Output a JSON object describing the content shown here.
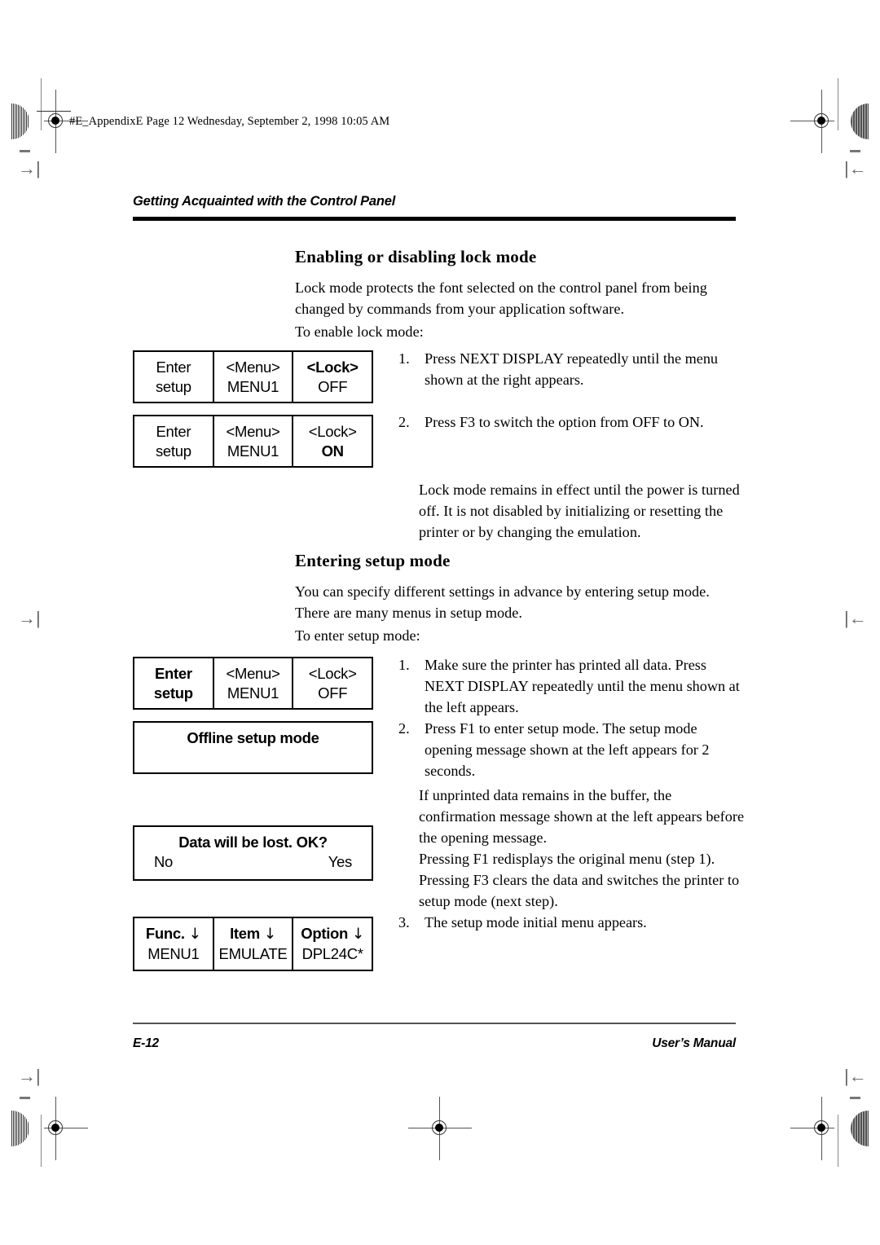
{
  "file_stamp": "#E_AppendixE  Page 12  Wednesday, September 2, 1998  10:05 AM",
  "running_head": "Getting Acquainted with the Control Panel",
  "sections": {
    "lock_mode": {
      "heading": "Enabling or disabling lock mode",
      "intro": "Lock mode protects the font selected on the control panel from being changed by commands from your application software.",
      "lead_in": "To enable lock mode:",
      "steps": [
        {
          "num": "1.",
          "text": "Press NEXT DISPLAY repeatedly until the menu shown at the right appears."
        },
        {
          "num": "2.",
          "text": "Press F3 to switch the option from OFF to ON."
        }
      ],
      "note": "Lock mode remains in effect until the power is turned off. It is not disabled by initializing or resetting the printer or by changing the emulation."
    },
    "setup_mode": {
      "heading": "Entering setup mode",
      "intro": "You can specify different settings in advance by entering setup mode. There are many menus in setup mode.",
      "lead_in": "To enter setup mode:",
      "steps": [
        {
          "num": "1.",
          "text": "Make sure the printer has printed all data. Press NEXT DISPLAY repeatedly until the menu shown at the left appears."
        },
        {
          "num": "2.",
          "text": "Press F1 to enter setup mode. The setup mode opening message shown at the left appears for 2 seconds."
        }
      ],
      "para_buffer": "If unprinted data remains in the buffer, the confirmation message shown at the left appears before the opening message.",
      "para_keys": "Pressing F1 redisplays the original menu (step 1). Pressing F3 clears the data and switches the printer to setup mode (next step).",
      "step3": {
        "num": "3.",
        "text": "The setup mode initial menu appears."
      }
    }
  },
  "panels": {
    "lock_off": {
      "cells": [
        {
          "top": "Enter",
          "top_bold": false,
          "bottom": "setup",
          "bottom_bold": false
        },
        {
          "top": "<Menu>",
          "top_bold": false,
          "bottom": "MENU1",
          "bottom_bold": false
        },
        {
          "top": "<Lock>",
          "top_bold": true,
          "bottom": "OFF",
          "bottom_bold": false
        }
      ]
    },
    "lock_on": {
      "cells": [
        {
          "top": "Enter",
          "top_bold": false,
          "bottom": "setup",
          "bottom_bold": false
        },
        {
          "top": "<Menu>",
          "top_bold": false,
          "bottom": "MENU1",
          "bottom_bold": false
        },
        {
          "top": "<Lock>",
          "top_bold": false,
          "bottom": "ON",
          "bottom_bold": true
        }
      ]
    },
    "enter_setup": {
      "cells": [
        {
          "top": "Enter",
          "top_bold": true,
          "bottom": "setup",
          "bottom_bold": true
        },
        {
          "top": "<Menu>",
          "top_bold": false,
          "bottom": "MENU1",
          "bottom_bold": false
        },
        {
          "top": "<Lock>",
          "top_bold": false,
          "bottom": "OFF",
          "bottom_bold": false
        }
      ]
    },
    "offline_setup": {
      "message": "Offline setup mode"
    },
    "data_lost": {
      "message": "Data will be lost. OK?",
      "left_option": "No",
      "right_option": "Yes"
    },
    "initial_menu": {
      "cells": [
        {
          "top": "Func.",
          "arrow": "↓",
          "bottom": "MENU1"
        },
        {
          "top": "Item",
          "arrow": "↓",
          "bottom": "EMULATE"
        },
        {
          "top": "Option",
          "arrow": "↓",
          "bottom": "DPL24C*"
        }
      ]
    }
  },
  "footer": {
    "page_number": "E-12",
    "manual_title": "User’s Manual"
  }
}
